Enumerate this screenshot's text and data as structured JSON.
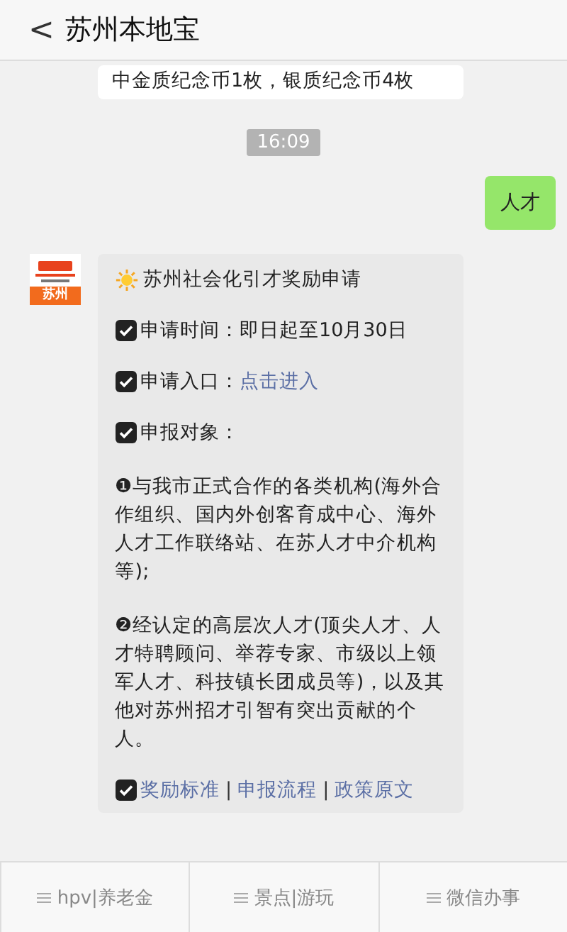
{
  "header": {
    "back": "<",
    "title": "苏州本地宝"
  },
  "messages": [
    {
      "kind": "text",
      "outgoing": false,
      "text": "中金质纪念币1枚，银质纪念币4枚"
    },
    {
      "kind": "time",
      "text": "16:09"
    },
    {
      "kind": "text",
      "outgoing": true,
      "text": "人才"
    },
    {
      "kind": "card",
      "outgoing": false,
      "avatar": {
        "label": "苏州"
      },
      "title": "苏州社会化引才奖励申请",
      "items": [
        {
          "kind": "field",
          "label": "申请时间：",
          "value": "即日起至10月30日"
        },
        {
          "kind": "link",
          "label": "申请入口：",
          "value": "点击进入"
        },
        {
          "kind": "heading",
          "label": "申报对象："
        }
      ],
      "paragraphs": [
        {
          "marker": "❶",
          "text": "与我市正式合作的各类机构(海外合作组织、国内外创客育成中心、海外人才工作联络站、在苏人才中介机构等);"
        },
        {
          "marker": "❷",
          "text": "经认定的高层次人才(顶尖人才、人才特聘顾问、举荐专家、市级以上领军人才、科技镇长团成员等)，以及其他对苏州招才引智有突出贡献的个人。"
        }
      ],
      "links": [
        {
          "kind": "link",
          "text": "奖励标准"
        },
        {
          "kind": "separator",
          "text": "|"
        },
        {
          "kind": "link",
          "text": "申报流程"
        },
        {
          "kind": "separator",
          "text": "|"
        },
        {
          "kind": "link",
          "text": "政策原文"
        }
      ]
    }
  ],
  "bottom_menu": [
    {
      "label": "hpv|养老金"
    },
    {
      "label": "景点|游玩"
    },
    {
      "label": "微信办事"
    }
  ]
}
